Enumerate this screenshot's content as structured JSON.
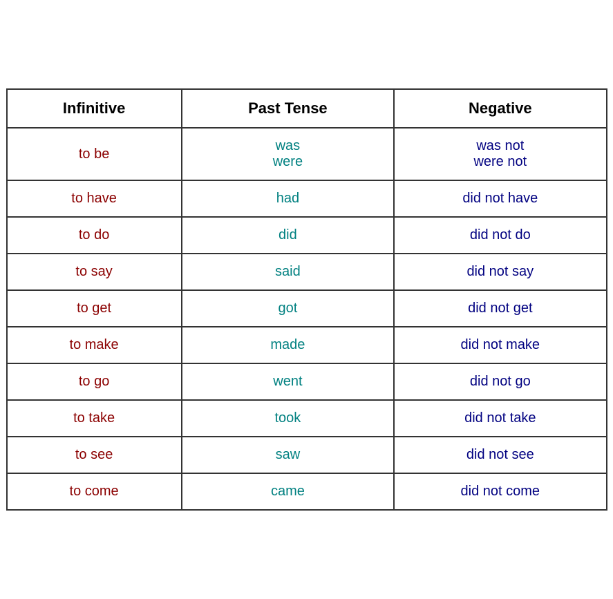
{
  "table": {
    "headers": {
      "col1": "Infinitive",
      "col2": "Past Tense",
      "col3": "Negative"
    },
    "rows": [
      {
        "infinitive": "to be",
        "past_tense": "was\nwere",
        "negative": "was not\nwere not"
      },
      {
        "infinitive": "to have",
        "past_tense": "had",
        "negative": "did not have"
      },
      {
        "infinitive": "to do",
        "past_tense": "did",
        "negative": "did not do"
      },
      {
        "infinitive": "to say",
        "past_tense": "said",
        "negative": "did not say"
      },
      {
        "infinitive": "to get",
        "past_tense": "got",
        "negative": "did not get"
      },
      {
        "infinitive": "to make",
        "past_tense": "made",
        "negative": "did not make"
      },
      {
        "infinitive": "to go",
        "past_tense": "went",
        "negative": "did not go"
      },
      {
        "infinitive": "to take",
        "past_tense": "took",
        "negative": "did not take"
      },
      {
        "infinitive": "to see",
        "past_tense": "saw",
        "negative": "did not see"
      },
      {
        "infinitive": "to come",
        "past_tense": "came",
        "negative": "did not come"
      }
    ]
  }
}
